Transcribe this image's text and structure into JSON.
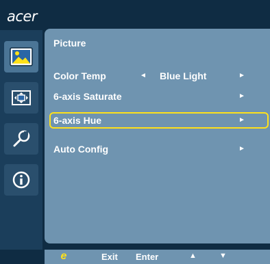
{
  "brand": "acer",
  "sidebar": {
    "items": [
      {
        "icon": "picture-icon",
        "active": true
      },
      {
        "icon": "display-position-icon",
        "active": false
      },
      {
        "icon": "settings-wrench-icon",
        "active": false
      },
      {
        "icon": "info-icon",
        "active": false
      }
    ]
  },
  "menu": {
    "title": "Picture",
    "rows": [
      {
        "label": "Color Temp",
        "value": "Blue Light",
        "left_arrow": "◄",
        "right_arrow": "►"
      },
      {
        "label": "6-axis Saturate",
        "right_arrow": "►"
      },
      {
        "label": "6-axis Hue",
        "right_arrow": "►",
        "selected": true
      },
      {
        "label": "Auto Config",
        "right_arrow": "►"
      }
    ]
  },
  "footer": {
    "empowering_label": "e",
    "exit_label": "Exit",
    "enter_label": "Enter",
    "up_label": "▲",
    "down_label": "▼"
  },
  "colors": {
    "accent": "#ffe11a",
    "panel": "#6f94b0",
    "background": "#0f2c43"
  }
}
